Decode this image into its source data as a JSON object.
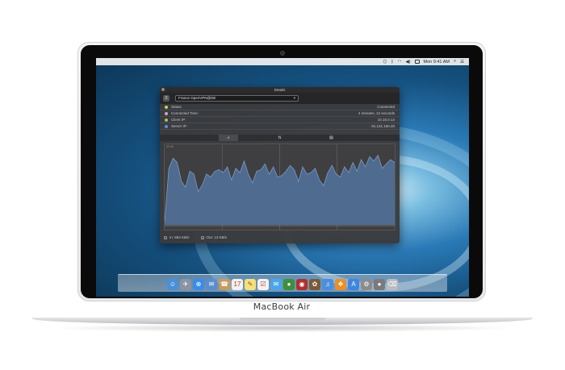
{
  "device": {
    "brand_label": "MacBook Air"
  },
  "menubar": {
    "time": "Mon 9:41 AM"
  },
  "window": {
    "title": "Details",
    "connection_select": {
      "value": "France OpenVPN@DE"
    },
    "rows": [
      {
        "label": "Status",
        "value": "Connected",
        "dot_color": "#c8d25a"
      },
      {
        "label": "Connected Time:",
        "value": "4 minutes, 12 seconds",
        "dot_color": "#d6a0d0"
      },
      {
        "label": "Client IP:",
        "value": "10.10.0.14",
        "dot_color": "#8fcf54"
      },
      {
        "label": "Server IP:",
        "value": "91.121.160.20",
        "dot_color": "#5a8be0"
      }
    ],
    "tabs": [
      {
        "icon": "graph-icon",
        "glyph": "⩘"
      },
      {
        "icon": "transfer-icon",
        "glyph": "⇅"
      },
      {
        "icon": "log-icon",
        "glyph": "▤"
      }
    ],
    "graph": {
      "axis_label": "50 kB",
      "fill_color": "#4f6b8f",
      "line_color": "#7e9ac0",
      "in_values": [
        0.04,
        0.78,
        0.92,
        0.86,
        0.6,
        0.52,
        0.74,
        0.7,
        0.46,
        0.55,
        0.7,
        0.66,
        0.74,
        0.76,
        0.72,
        0.8,
        0.62,
        0.78,
        0.72,
        0.88,
        0.7,
        0.58,
        0.74,
        0.76,
        0.84,
        0.7,
        0.8,
        0.66,
        0.68,
        0.74,
        0.82,
        0.76,
        0.6,
        0.8,
        0.7,
        0.72,
        0.78,
        0.62,
        0.54,
        0.72,
        0.82,
        0.7,
        0.66,
        0.8,
        0.72,
        0.86,
        0.74,
        0.9,
        0.8,
        0.94,
        0.88,
        0.96,
        0.78,
        0.84,
        0.9,
        0.86
      ]
    },
    "legend": {
      "in_label": "In: 884 KB/s",
      "out_label": "Out: 13 KB/s"
    }
  },
  "dock": {
    "items": [
      {
        "name": "finder-icon",
        "color": "#4a8fd8",
        "glyph": "☺"
      },
      {
        "name": "launchpad-icon",
        "color": "#8a94a2",
        "glyph": "✈"
      },
      {
        "name": "safari-icon",
        "color": "#3a8de6",
        "glyph": "⊕"
      },
      {
        "name": "mail-icon",
        "color": "#5b8ed0",
        "glyph": "✉"
      },
      {
        "name": "contacts-icon",
        "color": "#c89a5c",
        "glyph": "☎"
      },
      {
        "name": "calendar-icon",
        "color": "#f1f1f1",
        "glyph": "17"
      },
      {
        "name": "notes-icon",
        "color": "#f3e27a",
        "glyph": "✎"
      },
      {
        "name": "reminders-icon",
        "color": "#f2f2f2",
        "glyph": "☑"
      },
      {
        "name": "messages-icon",
        "color": "#4aa6e8",
        "glyph": "✉"
      },
      {
        "name": "facetime-icon",
        "color": "#3e8f3e",
        "glyph": "●"
      },
      {
        "name": "photobooth-icon",
        "color": "#b03030",
        "glyph": "◉"
      },
      {
        "name": "photos-icon",
        "color": "#7a5a3a",
        "glyph": "✿"
      },
      {
        "name": "itunes-icon",
        "color": "#4a8fe0",
        "glyph": "♫"
      },
      {
        "name": "ibooks-icon",
        "color": "#e8902a",
        "glyph": "❖"
      },
      {
        "name": "appstore-icon",
        "color": "#3f86e0",
        "glyph": "A"
      },
      {
        "name": "preferences-icon",
        "color": "#8c8c8c",
        "glyph": "⚙"
      },
      {
        "name": "vpn-icon",
        "color": "#7a7a7a",
        "glyph": "●"
      },
      {
        "name": "trash-icon",
        "color": "#b8bcc2",
        "glyph": "⌫"
      }
    ]
  }
}
